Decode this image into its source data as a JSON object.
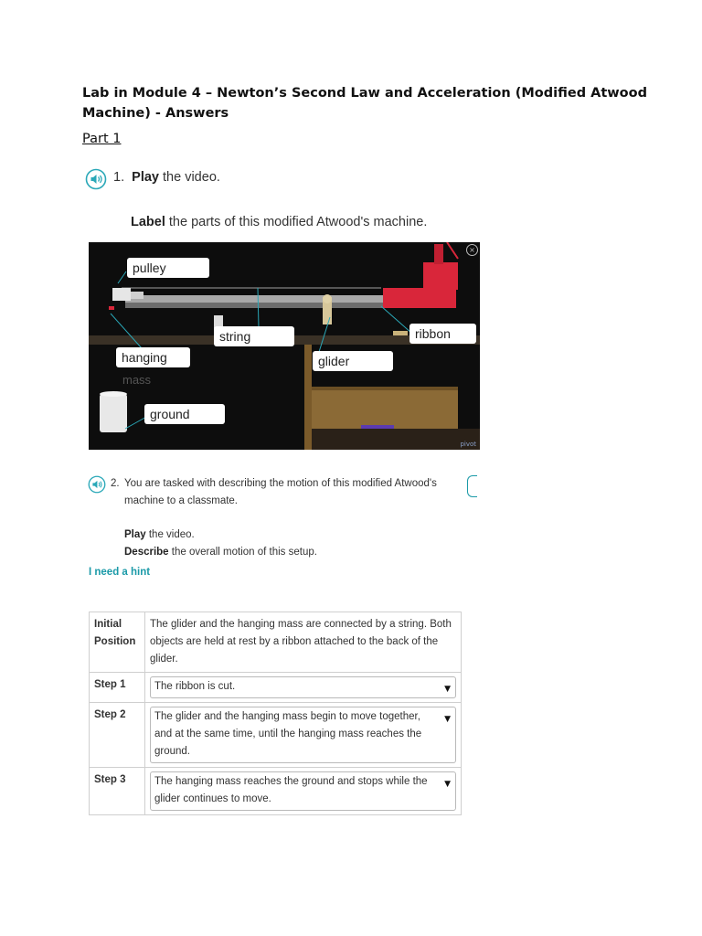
{
  "document": {
    "title": "Lab in Module 4 – Newton’s Second Law and Acceleration (Modified Atwood Machine) - Answers",
    "part_heading": "Part 1"
  },
  "question1": {
    "number": "1.",
    "verb": "Play",
    "rest": " the video.",
    "label_verb": "Label",
    "label_rest": " the parts of this modified Atwood's machine."
  },
  "video_labels": {
    "pulley": "pulley",
    "string": "string",
    "ribbon": "ribbon",
    "hanging": "hanging",
    "mass": "mass",
    "glider": "glider",
    "ground": "ground",
    "close": "×",
    "logo": "pivot"
  },
  "question2": {
    "number": "2.",
    "prompt": "You are tasked with describing the motion of this modified Atwood's machine to a classmate.",
    "play_verb": "Play",
    "play_rest": " the video.",
    "describe_verb": "Describe",
    "describe_rest": " the overall motion of this setup.",
    "hint": "I need a hint"
  },
  "steps_table": {
    "rows": [
      {
        "head": "Initial Position",
        "text": "The glider and the hanging mass are connected by a string. Both objects are held at rest by a ribbon attached to the back of the glider."
      },
      {
        "head": "Step 1",
        "text": "The ribbon is cut."
      },
      {
        "head": "Step 2",
        "text": "The glider and the hanging mass begin to move together, and at the same time, until the hanging mass reaches the ground."
      },
      {
        "head": "Step 3",
        "text": "The hanging mass reaches the ground and stops while the glider continues to move."
      }
    ],
    "caret": "▼"
  },
  "colors": {
    "accent_teal": "#1b9aa8",
    "lab_red": "#d9263a",
    "audio_icon": "#2aa8b8"
  },
  "icons": [
    "speaker-audio-icon",
    "dropdown-caret-icon",
    "close-icon"
  ]
}
